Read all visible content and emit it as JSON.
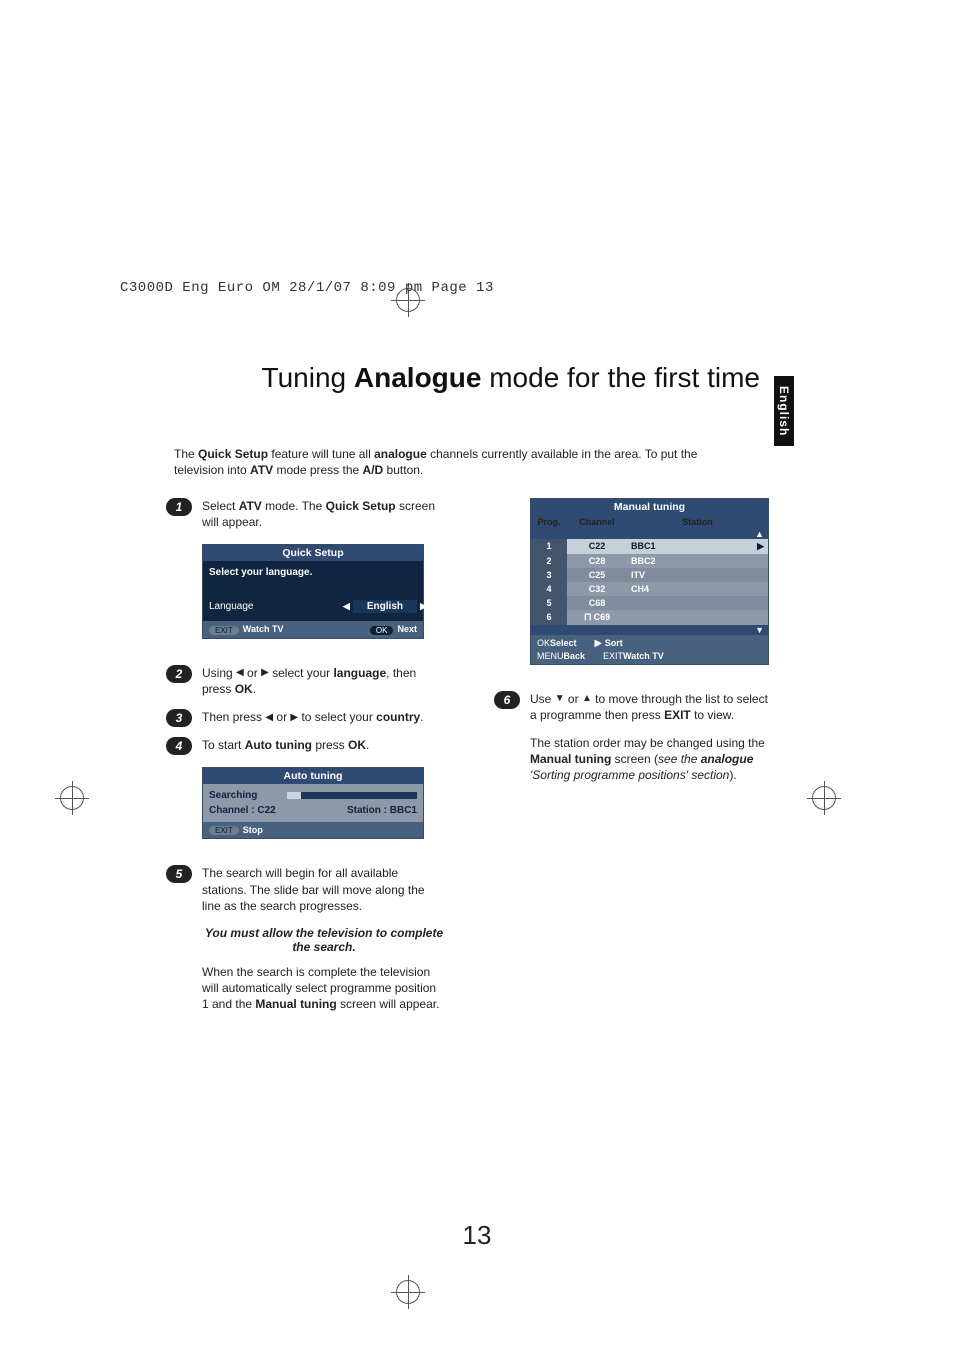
{
  "header": "C3000D Eng Euro OM  28/1/07  8:09 pm  Page 13",
  "side_tab": "English",
  "title_pre": "Tuning ",
  "title_bold": "Analogue",
  "title_post": " mode for the first time",
  "intro": {
    "t1": "The ",
    "b1": "Quick Setup",
    "t2": " feature will tune all ",
    "b2": "analogue",
    "t3": " channels currently available in the area. To put the television into ",
    "b3": "ATV",
    "t4": " mode press the ",
    "b4": "A/D",
    "t5": " button."
  },
  "step1": {
    "a": "Select ",
    "b": "ATV",
    "c": " mode. The ",
    "d": "Quick Setup",
    "e": " screen will appear."
  },
  "osd_qs": {
    "title": "Quick Setup",
    "prompt": "Select your language.",
    "label_lang": "Language",
    "value_lang": "English",
    "foot_exit": "EXIT",
    "foot_watch": "Watch TV",
    "foot_ok": "OK",
    "foot_next": "Next"
  },
  "step2": {
    "a": "Using ",
    "b": " or ",
    "c": " select your ",
    "d": "language",
    "e": ", then press ",
    "f": "OK",
    "g": "."
  },
  "step3": {
    "a": "Then press ",
    "b": " or ",
    "c": " to select your ",
    "d": "country",
    "e": "."
  },
  "step4": {
    "a": "To start ",
    "b": "Auto tuning",
    "c": " press ",
    "d": "OK",
    "e": "."
  },
  "osd_auto": {
    "title": "Auto tuning",
    "searching": "Searching",
    "channel_lbl": "Channel",
    "channel_val": "C22",
    "station_lbl": "Station",
    "station_val": "BBC1",
    "foot_exit": "EXIT",
    "foot_stop": "Stop"
  },
  "step5": {
    "p1": "The search will begin for all available stations. The slide bar will move along the line as the search progresses.",
    "note": "You must allow the television to complete the search.",
    "p2a": "When the search is complete the television will automatically select programme position 1 and the ",
    "p2b": "Manual tuning",
    "p2c": " screen will appear."
  },
  "osd_mt": {
    "title": "Manual tuning",
    "head_prog": "Prog.",
    "head_channel": "Channel",
    "head_station": "Station",
    "rows": [
      {
        "p": "1",
        "ch": "C22",
        "st": "BBC1"
      },
      {
        "p": "2",
        "ch": "C28",
        "st": "BBC2"
      },
      {
        "p": "3",
        "ch": "C25",
        "st": "ITV"
      },
      {
        "p": "4",
        "ch": "C32",
        "st": "CH4"
      },
      {
        "p": "5",
        "ch": "C68",
        "st": ""
      },
      {
        "p": "6",
        "ch": "C69",
        "st": "",
        "magnet": true
      }
    ],
    "foot_ok": "OK",
    "foot_select": "Select",
    "foot_sort": "Sort",
    "foot_menu": "MENU",
    "foot_back": "Back",
    "foot_exit": "EXIT",
    "foot_watch": "Watch TV"
  },
  "step6": {
    "p1a": "Use ",
    "p1b": " or ",
    "p1c": " to move through the list to select a programme then press ",
    "p1d": "EXIT",
    "p1e": " to view.",
    "p2a": "The station order may be changed using the ",
    "p2b": "Manual tuning",
    "p2c": " screen (",
    "p2it": "see the ",
    "p2bold_it": "analogue",
    "p2it2": " 'Sorting programme positions' section",
    "p2d": ")."
  },
  "page_number": "13"
}
